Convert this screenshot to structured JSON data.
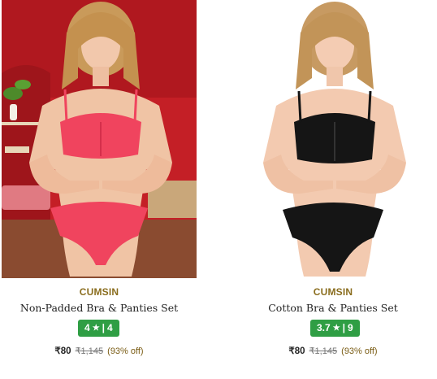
{
  "products": [
    {
      "brand": "CUMSIN",
      "title": "Non-Padded Bra & Panties Set",
      "rating": "4",
      "reviews": "4",
      "price": "₹80",
      "mrp": "₹1,145",
      "discount": "(93% off)",
      "colors": {
        "set": "#f0445e",
        "bg": "#c01d24",
        "badge": "#2f9e44"
      }
    },
    {
      "brand": "CUMSIN",
      "title": "Cotton Bra & Panties Set",
      "rating": "3.7",
      "reviews": "9",
      "price": "₹80",
      "mrp": "₹1,145",
      "discount": "(93% off)",
      "colors": {
        "set": "#151515",
        "bg": "#ffffff",
        "badge": "#2f9e44"
      }
    }
  ],
  "icons": {
    "star": "star-icon",
    "divider": "|"
  }
}
